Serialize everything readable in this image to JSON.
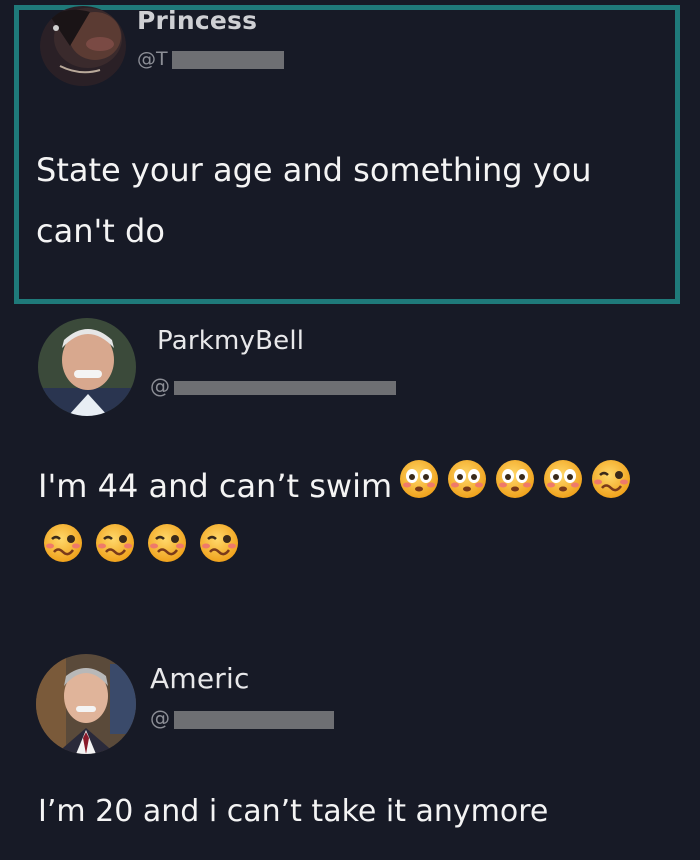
{
  "tweets": [
    {
      "name": "Princess",
      "handle_prefix": "@",
      "handle_visible": "T",
      "text_line1": "State your age and something you",
      "text_line2": "can't do"
    },
    {
      "name": "ParkmyBell",
      "handle_prefix": "@",
      "text": "I'm 44 and can’t swim",
      "emojis": [
        "flushed-face",
        "flushed-face",
        "flushed-face",
        "flushed-face",
        "woozy-face",
        "woozy-face",
        "woozy-face",
        "woozy-face",
        "woozy-face"
      ]
    },
    {
      "name": "Americ",
      "handle_prefix": "@",
      "text": "I’m 20 and i can’t take it anymore"
    }
  ],
  "colors": {
    "background": "#171a26",
    "highlight_border": "#1f7a7a",
    "handle_gray": "#8c8e96",
    "redaction_gray": "#6e6f73"
  }
}
